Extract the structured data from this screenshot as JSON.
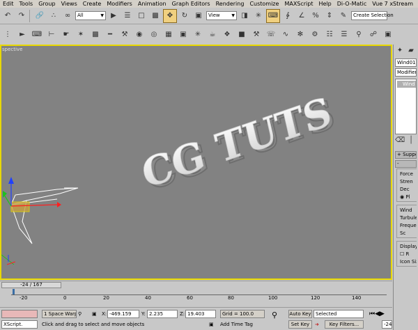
{
  "menu": [
    "Edit",
    "Tools",
    "Group",
    "Views",
    "Create",
    "Modifiers",
    "Animation",
    "Graph Editors",
    "Rendering",
    "Customize",
    "MAXScript",
    "Help",
    "Di-O-Matic",
    "Vue 7 xStream"
  ],
  "toolbar": {
    "filter_value": "All",
    "refcoord_value": "View",
    "named_sel_placeholder": "Create Selection"
  },
  "viewport": {
    "label": "spective",
    "text_3d": "CG TUTS",
    "border_color": "#e8d800",
    "bg_color": "#828282"
  },
  "command_panel": {
    "object_name": "Wind01",
    "modifier_list": "Modifier Li",
    "stack_item": "Wind",
    "rollout_support": "Suppo",
    "rollout_minus": "-",
    "force_group": "Force",
    "strength": "Stren",
    "decay": "Dec",
    "planar_radio": "Pl",
    "wind_group": "Wind",
    "turbulence": "Turbulen",
    "frequency": "Frequen",
    "scale": "Sc",
    "display_group": "Display",
    "range_check": "R",
    "icon_size": "Icon Siz"
  },
  "timeline": {
    "current": "-24 / 167",
    "ticks": [
      "-20",
      "0",
      "20",
      "40",
      "60",
      "80",
      "100",
      "120",
      "140"
    ]
  },
  "status": {
    "selection_count": "1 Space Warp",
    "x_label": "X:",
    "x_value": "-469.159",
    "y_label": "Y:",
    "y_value": "2.235",
    "z_label": "Z:",
    "z_value": "19.403",
    "grid": "Grid = 100.0",
    "auto_key": "Auto Key",
    "key_mode": "Selected",
    "set_key": "Set Key",
    "key_filters": "Key Filters...",
    "prompt": "Click and drag to select and move objects",
    "add_time_tag": "Add Time Tag",
    "maxscript": "XScript.",
    "frame_field": "-24"
  }
}
